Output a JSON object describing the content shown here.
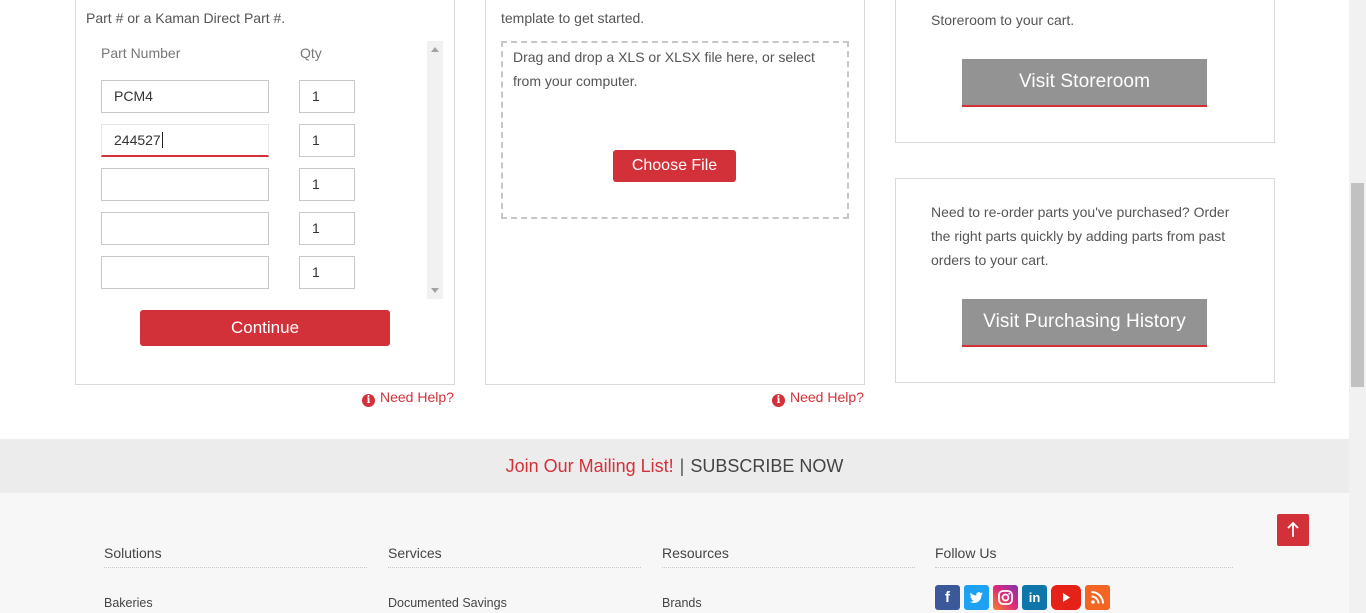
{
  "quick_order": {
    "intro_line1": "Part # or a Kaman Direct Part #.",
    "col_part": "Part Number",
    "col_qty": "Qty",
    "rows": [
      {
        "part": "PCM4",
        "qty": "1"
      },
      {
        "part": "244527",
        "qty": "1"
      },
      {
        "part": "",
        "qty": "1"
      },
      {
        "part": "",
        "qty": "1"
      },
      {
        "part": "",
        "qty": "1"
      }
    ],
    "continue_label": "Continue",
    "help_label": "Need Help?"
  },
  "upload": {
    "intro_line": "template to get started.",
    "drop_text": "Drag and drop a XLS or XLSX file here, or select from your computer.",
    "choose_label": "Choose File",
    "help_label": "Need Help?"
  },
  "storeroom": {
    "text_line": "Storeroom to your cart.",
    "button_label": "Visit Storeroom"
  },
  "history": {
    "text": "Need to re-order parts you've purchased? Order the right parts quickly by adding parts from past orders to your cart.",
    "button_label": "Visit Purchasing History"
  },
  "mailing": {
    "join_label": "Join Our Mailing List!",
    "separator": "|",
    "subscribe_label": "SUBSCRIBE NOW"
  },
  "footer": {
    "columns": [
      {
        "heading": "Solutions",
        "first_item": "Bakeries"
      },
      {
        "heading": "Services",
        "first_item": "Documented Savings"
      },
      {
        "heading": "Resources",
        "first_item": "Brands"
      },
      {
        "heading": "Follow Us"
      }
    ],
    "social_icons": [
      "facebook-icon",
      "twitter-icon",
      "instagram-icon",
      "linkedin-icon",
      "youtube-icon",
      "rss-icon"
    ]
  },
  "colors": {
    "brand_red": "#d3313a",
    "button_gray": "#939393",
    "mailing_bg": "#ececec"
  }
}
